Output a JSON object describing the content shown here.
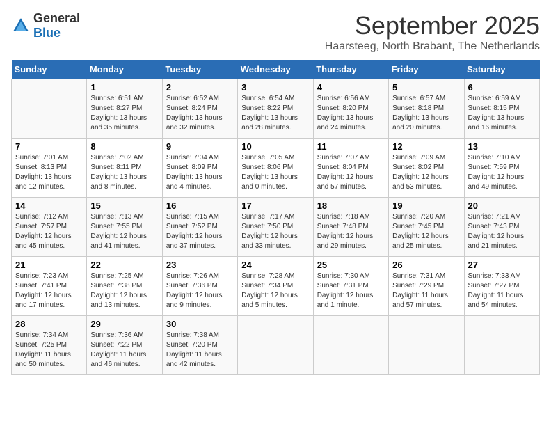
{
  "header": {
    "logo": {
      "general": "General",
      "blue": "Blue"
    },
    "title": "September 2025",
    "location": "Haarsteeg, North Brabant, The Netherlands"
  },
  "weekdays": [
    "Sunday",
    "Monday",
    "Tuesday",
    "Wednesday",
    "Thursday",
    "Friday",
    "Saturday"
  ],
  "weeks": [
    [
      {
        "day": "",
        "info": ""
      },
      {
        "day": "1",
        "info": "Sunrise: 6:51 AM\nSunset: 8:27 PM\nDaylight: 13 hours\nand 35 minutes."
      },
      {
        "day": "2",
        "info": "Sunrise: 6:52 AM\nSunset: 8:24 PM\nDaylight: 13 hours\nand 32 minutes."
      },
      {
        "day": "3",
        "info": "Sunrise: 6:54 AM\nSunset: 8:22 PM\nDaylight: 13 hours\nand 28 minutes."
      },
      {
        "day": "4",
        "info": "Sunrise: 6:56 AM\nSunset: 8:20 PM\nDaylight: 13 hours\nand 24 minutes."
      },
      {
        "day": "5",
        "info": "Sunrise: 6:57 AM\nSunset: 8:18 PM\nDaylight: 13 hours\nand 20 minutes."
      },
      {
        "day": "6",
        "info": "Sunrise: 6:59 AM\nSunset: 8:15 PM\nDaylight: 13 hours\nand 16 minutes."
      }
    ],
    [
      {
        "day": "7",
        "info": "Sunrise: 7:01 AM\nSunset: 8:13 PM\nDaylight: 13 hours\nand 12 minutes."
      },
      {
        "day": "8",
        "info": "Sunrise: 7:02 AM\nSunset: 8:11 PM\nDaylight: 13 hours\nand 8 minutes."
      },
      {
        "day": "9",
        "info": "Sunrise: 7:04 AM\nSunset: 8:09 PM\nDaylight: 13 hours\nand 4 minutes."
      },
      {
        "day": "10",
        "info": "Sunrise: 7:05 AM\nSunset: 8:06 PM\nDaylight: 13 hours\nand 0 minutes."
      },
      {
        "day": "11",
        "info": "Sunrise: 7:07 AM\nSunset: 8:04 PM\nDaylight: 12 hours\nand 57 minutes."
      },
      {
        "day": "12",
        "info": "Sunrise: 7:09 AM\nSunset: 8:02 PM\nDaylight: 12 hours\nand 53 minutes."
      },
      {
        "day": "13",
        "info": "Sunrise: 7:10 AM\nSunset: 7:59 PM\nDaylight: 12 hours\nand 49 minutes."
      }
    ],
    [
      {
        "day": "14",
        "info": "Sunrise: 7:12 AM\nSunset: 7:57 PM\nDaylight: 12 hours\nand 45 minutes."
      },
      {
        "day": "15",
        "info": "Sunrise: 7:13 AM\nSunset: 7:55 PM\nDaylight: 12 hours\nand 41 minutes."
      },
      {
        "day": "16",
        "info": "Sunrise: 7:15 AM\nSunset: 7:52 PM\nDaylight: 12 hours\nand 37 minutes."
      },
      {
        "day": "17",
        "info": "Sunrise: 7:17 AM\nSunset: 7:50 PM\nDaylight: 12 hours\nand 33 minutes."
      },
      {
        "day": "18",
        "info": "Sunrise: 7:18 AM\nSunset: 7:48 PM\nDaylight: 12 hours\nand 29 minutes."
      },
      {
        "day": "19",
        "info": "Sunrise: 7:20 AM\nSunset: 7:45 PM\nDaylight: 12 hours\nand 25 minutes."
      },
      {
        "day": "20",
        "info": "Sunrise: 7:21 AM\nSunset: 7:43 PM\nDaylight: 12 hours\nand 21 minutes."
      }
    ],
    [
      {
        "day": "21",
        "info": "Sunrise: 7:23 AM\nSunset: 7:41 PM\nDaylight: 12 hours\nand 17 minutes."
      },
      {
        "day": "22",
        "info": "Sunrise: 7:25 AM\nSunset: 7:38 PM\nDaylight: 12 hours\nand 13 minutes."
      },
      {
        "day": "23",
        "info": "Sunrise: 7:26 AM\nSunset: 7:36 PM\nDaylight: 12 hours\nand 9 minutes."
      },
      {
        "day": "24",
        "info": "Sunrise: 7:28 AM\nSunset: 7:34 PM\nDaylight: 12 hours\nand 5 minutes."
      },
      {
        "day": "25",
        "info": "Sunrise: 7:30 AM\nSunset: 7:31 PM\nDaylight: 12 hours\nand 1 minute."
      },
      {
        "day": "26",
        "info": "Sunrise: 7:31 AM\nSunset: 7:29 PM\nDaylight: 11 hours\nand 57 minutes."
      },
      {
        "day": "27",
        "info": "Sunrise: 7:33 AM\nSunset: 7:27 PM\nDaylight: 11 hours\nand 54 minutes."
      }
    ],
    [
      {
        "day": "28",
        "info": "Sunrise: 7:34 AM\nSunset: 7:25 PM\nDaylight: 11 hours\nand 50 minutes."
      },
      {
        "day": "29",
        "info": "Sunrise: 7:36 AM\nSunset: 7:22 PM\nDaylight: 11 hours\nand 46 minutes."
      },
      {
        "day": "30",
        "info": "Sunrise: 7:38 AM\nSunset: 7:20 PM\nDaylight: 11 hours\nand 42 minutes."
      },
      {
        "day": "",
        "info": ""
      },
      {
        "day": "",
        "info": ""
      },
      {
        "day": "",
        "info": ""
      },
      {
        "day": "",
        "info": ""
      }
    ]
  ]
}
